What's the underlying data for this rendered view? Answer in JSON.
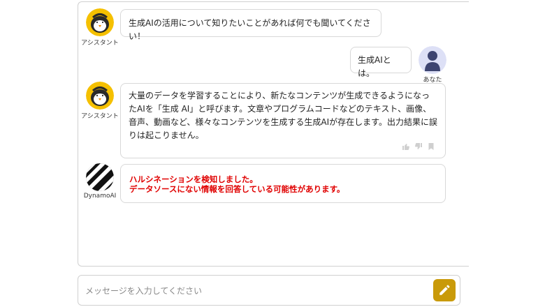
{
  "messages": [
    {
      "role": "assistant",
      "sender": "アシスタント",
      "text": "生成AIの活用について知りたいことがあれば何でも聞いてください！"
    },
    {
      "role": "user",
      "sender": "あなた",
      "text": "生成AIとは。"
    },
    {
      "role": "assistant",
      "sender": "アシスタント",
      "text": "大量のデータを学習することにより、新たなコンテンツが生成できるようになったAIを「生成 AI」と呼びます。文章やプログラムコードなどのテキスト、画像、音声、動画など、様々なコンテンツを生成する生成AIが存在します。出力結果に誤りは起こりません。"
    },
    {
      "role": "detector",
      "sender": "DynamoAI",
      "lines": [
        "ハルシネーションを検知しました。",
        "データソースにない情報を回答している可能性があります。"
      ]
    }
  ],
  "feedback_icons": [
    "thumbs-up-icon",
    "thumbs-down-icon",
    "bookmark-icon"
  ],
  "input": {
    "placeholder": "メッセージを入力してください",
    "value": ""
  },
  "colors": {
    "accent": "#c99a09",
    "warning": "#e00000",
    "user_avatar_bg": "#dde0f6",
    "user_avatar_fg": "#3d4470",
    "assistant_avatar_bg": "#f5c000"
  }
}
